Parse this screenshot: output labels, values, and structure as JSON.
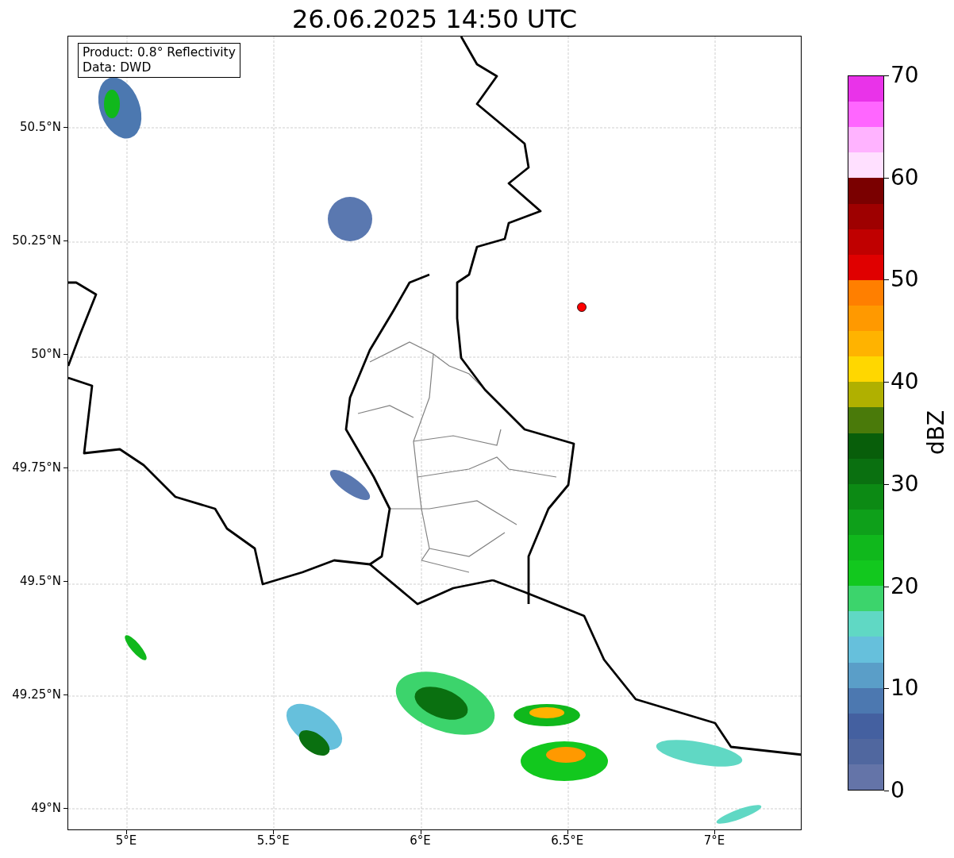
{
  "title": "26.06.2025 14:50 UTC",
  "info_box": [
    "Product: 0.8° Reflectivity",
    "Data: DWD"
  ],
  "y_axis": {
    "ticks": [
      {
        "label": "50.5°N"
      },
      {
        "label": "50.25°N"
      },
      {
        "label": "50°N"
      },
      {
        "label": "49.75°N"
      },
      {
        "label": "49.5°N"
      },
      {
        "label": "49.25°N"
      },
      {
        "label": "49°N"
      }
    ]
  },
  "x_axis": {
    "ticks": [
      {
        "label": "5°E"
      },
      {
        "label": "5.5°E"
      },
      {
        "label": "6°E"
      },
      {
        "label": "6.5°E"
      },
      {
        "label": "7°E"
      }
    ]
  },
  "colorbar": {
    "label": "dBZ",
    "ticks": [
      "70",
      "60",
      "50",
      "40",
      "30",
      "20",
      "10",
      "0"
    ],
    "bands": [
      {
        "color": "#e933e9"
      },
      {
        "color": "#ff66ff"
      },
      {
        "color": "#ffb3ff"
      },
      {
        "color": "#ffe0ff"
      },
      {
        "color": "#7a0000"
      },
      {
        "color": "#9e0000"
      },
      {
        "color": "#c00000"
      },
      {
        "color": "#e00000"
      },
      {
        "color": "#ff7f00"
      },
      {
        "color": "#ff9900"
      },
      {
        "color": "#ffb300"
      },
      {
        "color": "#ffd700"
      },
      {
        "color": "#b0b000"
      },
      {
        "color": "#4a7a0a"
      },
      {
        "color": "#085e0a"
      },
      {
        "color": "#0a7010"
      },
      {
        "color": "#0c8a14"
      },
      {
        "color": "#0ea01a"
      },
      {
        "color": "#10b81c"
      },
      {
        "color": "#12c81e"
      },
      {
        "color": "#3cd46c"
      },
      {
        "color": "#60d8c4"
      },
      {
        "color": "#66c0dc"
      },
      {
        "color": "#5a9ec8"
      },
      {
        "color": "#4c78b0"
      },
      {
        "color": "#4460a0"
      },
      {
        "color": "#50679f"
      },
      {
        "color": "#6474a8"
      }
    ]
  }
}
